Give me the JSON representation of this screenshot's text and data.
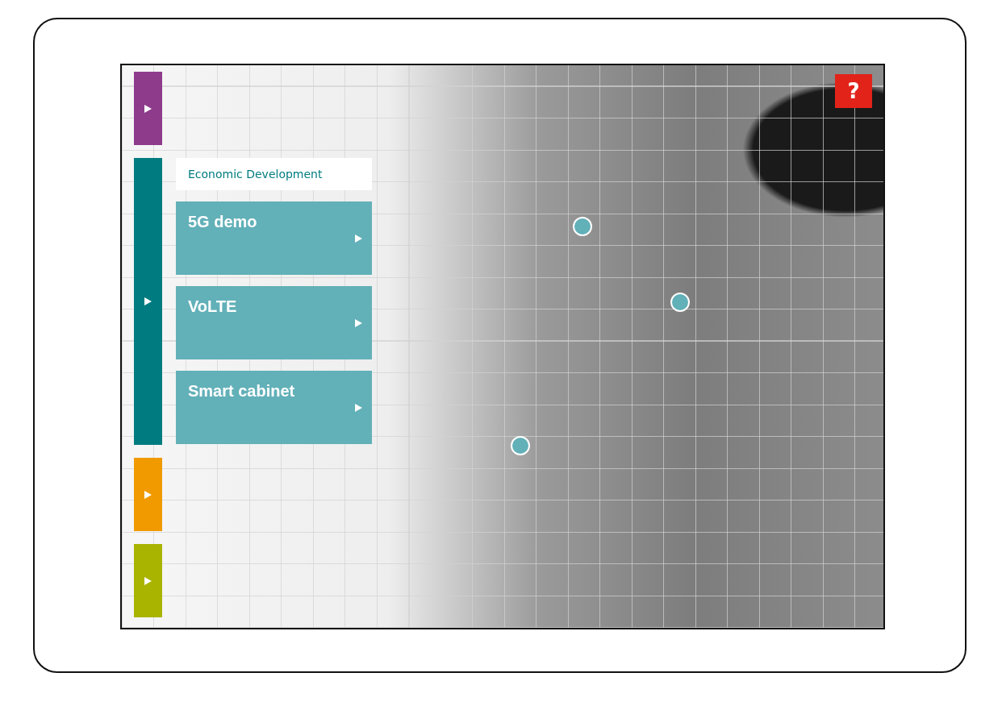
{
  "help_button": {
    "label": "?"
  },
  "side_tabs": [
    {
      "color": "#8e3b8c",
      "expanded": false
    },
    {
      "color": "#007c80",
      "expanded": true,
      "section_label": "Economic Development",
      "cards": [
        {
          "title": "5G demo"
        },
        {
          "title": "VoLTE"
        },
        {
          "title": "Smart cabinet"
        }
      ]
    },
    {
      "color": "#f09a00",
      "expanded": false
    },
    {
      "color": "#a8b400",
      "expanded": false
    }
  ]
}
